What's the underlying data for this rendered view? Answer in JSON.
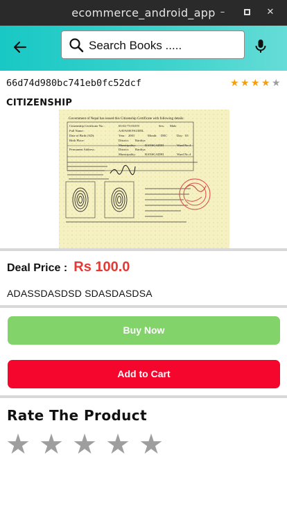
{
  "window": {
    "title": "ecommerce_android_app",
    "min_glyph": "–",
    "max_glyph": "▫",
    "close_glyph": "✕"
  },
  "appbar": {
    "back_icon": "arrow-back-icon",
    "search": {
      "placeholder": "Search Books .....",
      "icon": "search-icon"
    },
    "mic_icon": "mic-icon",
    "gradient": [
      "#18c8c4",
      "#66dcd7"
    ]
  },
  "product": {
    "id": "66d74d980bc741eb0fc52dcf",
    "rating": {
      "value": 4,
      "max": 5,
      "filled_color": "#f59e0b",
      "empty_color": "#9e9e9e"
    },
    "name": "CITIZENSHIP",
    "image": {
      "header_text": "Government of Nepal has issued this Citizenship Certificate with following details:",
      "cert_label": "Citizenship Certificate No.:",
      "cert_no": "65-02-75-01019",
      "sex_label": "Sex:",
      "sex": "Male",
      "fullname_label": "Full Name:",
      "fullname": "AAVASH PAUDEL",
      "dob_label": "Date of Birth (AD):",
      "year_label": "Year:",
      "year": "2001",
      "month_label": "Month:",
      "month": "DEC",
      "day_label": "Day:",
      "day": "03",
      "birthplace_label": "Birth Place:",
      "district_label": "District:",
      "district": "Bardiya",
      "municipality_label": "Municipality:",
      "municipality": "BANSGADHI",
      "ward_label": "Ward No.",
      "ward": "4",
      "address_label": "Permanent Address:"
    },
    "deal_label": "Deal Price :",
    "deal_price": "Rs 100.0",
    "description": "ADASSDASDSD SDASDASDSA"
  },
  "actions": {
    "buy_label": "Buy Now",
    "cart_label": "Add to Cart",
    "buy_color": "#82d36a",
    "cart_color": "#f4062d"
  },
  "rate": {
    "heading": "Rate The Product",
    "stars": 5,
    "current": 0,
    "star_color": "#9e9e9e"
  }
}
